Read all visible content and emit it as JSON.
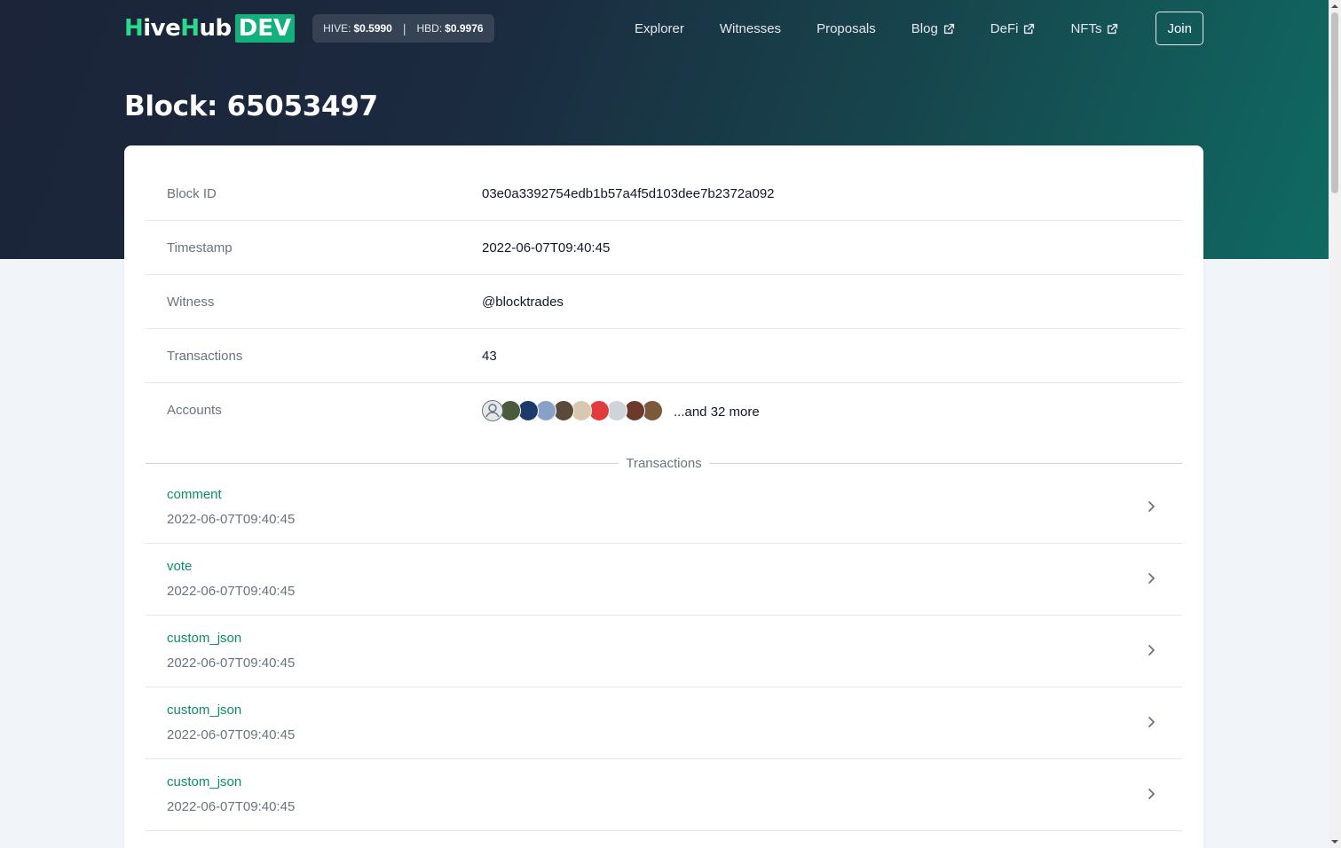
{
  "header": {
    "logo_prefix_h": "H",
    "logo_mid": "ive",
    "logo_h2": "H",
    "logo_suffix": "ub",
    "logo_dev": "DEV",
    "hive_label": "HIVE:",
    "hive_price": "$0.5990",
    "hbd_label": "HBD:",
    "hbd_price": "$0.9976",
    "nav": [
      {
        "label": "Explorer",
        "external": false
      },
      {
        "label": "Witnesses",
        "external": false
      },
      {
        "label": "Proposals",
        "external": false
      },
      {
        "label": "Blog",
        "external": true
      },
      {
        "label": "DeFi",
        "external": true
      },
      {
        "label": "NFTs",
        "external": true
      }
    ],
    "join_label": "Join"
  },
  "page_title": "Block: 65053497",
  "block": {
    "rows": [
      {
        "label": "Block ID",
        "value": "03e0a3392754edb1b57a4f5d103dee7b2372a092"
      },
      {
        "label": "Timestamp",
        "value": "2022-06-07T09:40:45"
      },
      {
        "label": "Witness",
        "value": "@blocktrades"
      },
      {
        "label": "Transactions",
        "value": "43"
      }
    ],
    "accounts_label": "Accounts",
    "accounts_more": "...and 32 more",
    "avatar_colors": [
      "#e5e7eb",
      "#4a5a3a",
      "#1e3a6b",
      "#8aa0c8",
      "#5b4a3a",
      "#d9c8b0",
      "#e23b3b",
      "#cfd4da",
      "#6b3a2a",
      "#7a5a3a"
    ]
  },
  "transactions_label": "Transactions",
  "transactions": [
    {
      "type": "comment",
      "time": "2022-06-07T09:40:45"
    },
    {
      "type": "vote",
      "time": "2022-06-07T09:40:45"
    },
    {
      "type": "custom_json",
      "time": "2022-06-07T09:40:45"
    },
    {
      "type": "custom_json",
      "time": "2022-06-07T09:40:45"
    },
    {
      "type": "custom_json",
      "time": "2022-06-07T09:40:45"
    }
  ],
  "icons": {
    "external": "external-link-icon",
    "chevron": "chevron-right-icon"
  }
}
